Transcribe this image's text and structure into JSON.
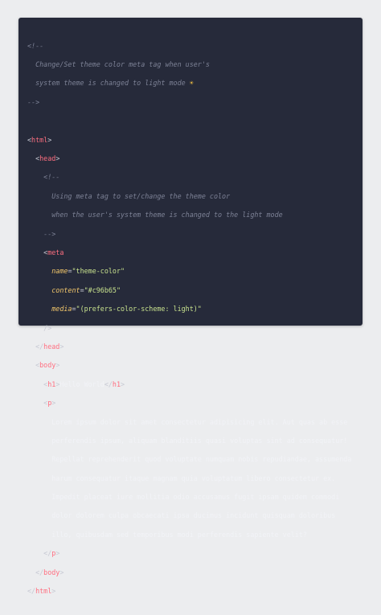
{
  "code": {
    "comment_top_open": "<!--",
    "comment_top_line1": "Change/Set theme color meta tag when user's",
    "comment_top_line2": "system theme is changed to light mode",
    "comment_top_emoji": "☀",
    "comment_top_close": "-->",
    "tag_html": "html",
    "tag_head": "head",
    "comment_inner_open": "<!--",
    "comment_inner_line1": "Using meta tag to set/change the theme color",
    "comment_inner_line2": "when the user's system theme is changed to the light mode",
    "comment_inner_close": "-->",
    "tag_meta": "meta",
    "attr_name": "name",
    "val_name": "\"theme-color\"",
    "attr_content": "content",
    "val_content": "\"#c96b65\"",
    "attr_media": "media",
    "val_media": "\"(prefers-color-scheme: light)\"",
    "self_close": "/>",
    "tag_body": "body",
    "tag_h1": "h1",
    "h1_text": "Hello World",
    "tag_p": "p",
    "p_line1": "Lorem ipsum dolor sit amet consectetur adipisicing elit. Aut quas ab esse",
    "p_line2": "perferendis ipsum, aliquam blanditiis quasi voluptas sint ad consequatur!",
    "p_line3": "Repellat reprehenderit quod voluptate numquam nobis repudiandae, assumenda",
    "p_line4": "harum consequatur itaque magnam quia voluptatum libero consectetur ex.",
    "p_line5": "Impedit placeat iure mollitia odio accusamus fugit ipsam quidem commodi",
    "p_line6": "dolor dolorem culpa obcaecati ipsa ducimus incidunt quisquam doloribus",
    "p_line7": "illo, quibusdam sed temporibus modi perferendis sapiente velit?"
  },
  "colors": {
    "background": "#262a3a",
    "tag": "#ff6f80",
    "attribute": "#f3c76b",
    "string": "#c8e28e",
    "comment": "#7d8296"
  }
}
